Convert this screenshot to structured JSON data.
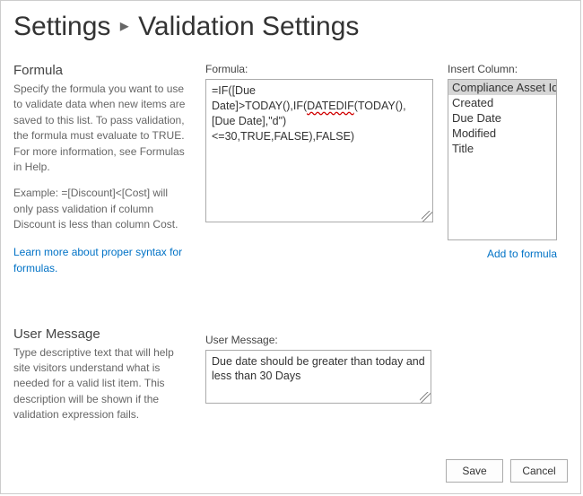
{
  "breadcrumb": {
    "settings": "Settings",
    "page": "Validation Settings"
  },
  "formula_section": {
    "title": "Formula",
    "description": "Specify the formula you want to use to validate data when new items are saved to this list. To pass validation, the formula must evaluate to TRUE. For more information, see Formulas in Help.",
    "example": "Example: =[Discount]<[Cost] will only pass validation if column Discount is less than column Cost.",
    "link": "Learn more about proper syntax for formulas.",
    "label": "Formula:",
    "value_pre": "=IF([Due Date]>TODAY(),IF(",
    "value_err": "DATEDIF",
    "value_post": "(TODAY(),[Due Date],\"d\")<=30,TRUE,FALSE),FALSE)"
  },
  "insert_column": {
    "label": "Insert Column:",
    "options": [
      "Compliance Asset Id",
      "Created",
      "Due Date",
      "Modified",
      "Title"
    ],
    "selected_index": 0,
    "add_link": "Add to formula"
  },
  "user_message_section": {
    "title": "User Message",
    "description": "Type descriptive text that will help site visitors understand what is needed for a valid list item. This description will be shown if the validation expression fails.",
    "label": "User Message:",
    "value": "Due date should be greater than today and less than 30 Days"
  },
  "buttons": {
    "save": "Save",
    "cancel": "Cancel"
  }
}
